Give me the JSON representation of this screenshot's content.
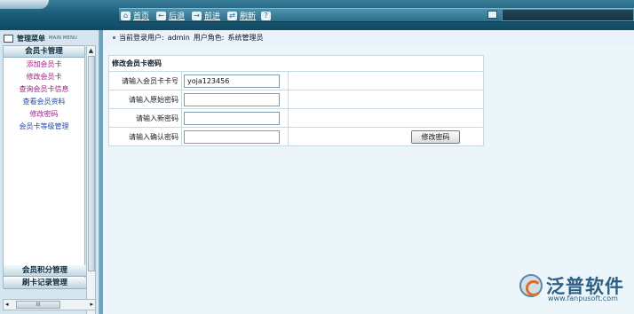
{
  "header": {
    "nav": [
      {
        "label": "首页",
        "icon": "home-icon",
        "glyph": "⌂"
      },
      {
        "label": "后退",
        "icon": "back-arrow-icon",
        "glyph": "←"
      },
      {
        "label": "前进",
        "icon": "forward-arrow-icon",
        "glyph": "→"
      },
      {
        "label": "刷新",
        "icon": "refresh-icon",
        "glyph": "⇄"
      },
      {
        "label": "",
        "icon": "help-icon",
        "glyph": "?"
      }
    ]
  },
  "sidebar": {
    "title": "管理菜单",
    "subtitle": "MAIN MENU",
    "active_section": "会员卡管理",
    "items": [
      {
        "label": "添加会员卡",
        "color": "#b0188c"
      },
      {
        "label": "修改会员卡",
        "color": "#b0188c"
      },
      {
        "label": "查询会员卡信息",
        "color": "#b0188c"
      },
      {
        "label": "查看会员资料",
        "color": "#2549b8"
      },
      {
        "label": "修改密码",
        "color": "#b0188c"
      },
      {
        "label": "会员卡等级管理",
        "color": "#2549b8"
      }
    ],
    "bottom_sections": [
      "会员积分管理",
      "刷卡记录管理"
    ],
    "hscroll_label": "III"
  },
  "userbar": {
    "user_label": "当前登录用户:",
    "user": "admin",
    "role_label": "用户角色:",
    "role": "系统管理员"
  },
  "form": {
    "title": "修改会员卡密码",
    "fields": [
      {
        "label": "请输入会员卡卡号",
        "value": "yoja123456"
      },
      {
        "label": "请输入原始密码",
        "value": ""
      },
      {
        "label": "请输入新密码",
        "value": ""
      },
      {
        "label": "请输入确认密码",
        "value": ""
      }
    ],
    "submit_label": "修改密码"
  },
  "watermark": {
    "brand": "泛普软件",
    "url": "www.fanpusoft.com"
  }
}
